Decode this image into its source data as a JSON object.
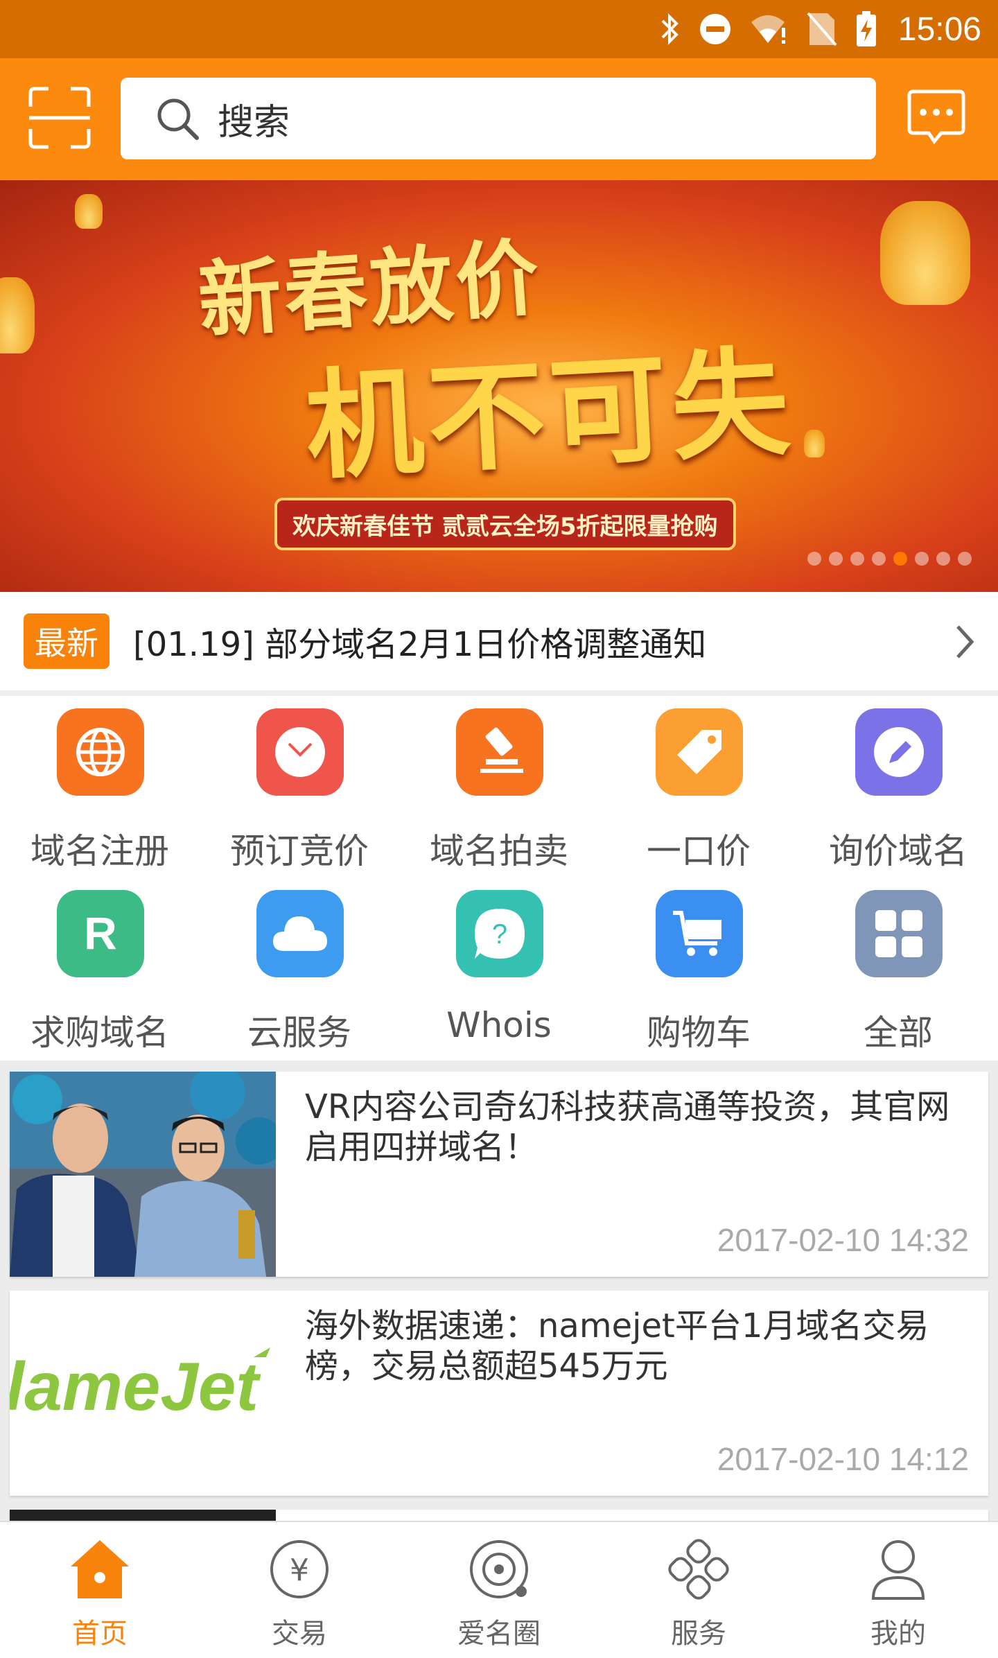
{
  "status_bar": {
    "time": "15:06"
  },
  "top_bar": {
    "search_placeholder": "搜索"
  },
  "banner": {
    "title_line1": "新春放价",
    "title_line2": "机不可失",
    "subtitle": "欢庆新春佳节 贰贰云全场5折起限量抢购",
    "dot_count": 8,
    "active_dot": 4
  },
  "notice": {
    "badge": "最新",
    "text": "[01.19] 部分域名2月1日价格调整通知"
  },
  "grid": {
    "items": [
      {
        "label": "域名注册",
        "icon": "globe-icon",
        "color": "#f8731f"
      },
      {
        "label": "预订竞价",
        "icon": "clock-icon",
        "color": "#f0554b"
      },
      {
        "label": "域名拍卖",
        "icon": "gavel-icon",
        "color": "#f8731f"
      },
      {
        "label": "一口价",
        "icon": "tag-icon",
        "color": "#fb9f33"
      },
      {
        "label": "询价域名",
        "icon": "pencil-icon",
        "color": "#7a72e6"
      },
      {
        "label": "求购域名",
        "icon": "r-letter-icon",
        "color": "#3cbb86"
      },
      {
        "label": "云服务",
        "icon": "cloud-icon",
        "color": "#3d9cf0"
      },
      {
        "label": "Whois",
        "icon": "question-bubble-icon",
        "color": "#35c1b2"
      },
      {
        "label": "购物车",
        "icon": "cart-icon",
        "color": "#3a8ff0"
      },
      {
        "label": "全部",
        "icon": "grid-icon",
        "color": "#8096b8"
      }
    ]
  },
  "feed": {
    "articles": [
      {
        "title": "VR内容公司奇幻科技获高通等投资，其官网启用四拼域名！",
        "time": "2017-02-10 14:32"
      },
      {
        "title": "海外数据速递：namejet平台1月域名交易榜，交易总额超545万元",
        "time": "2017-02-10 14:12",
        "thumb_text": "lameJet"
      }
    ]
  },
  "bottom_nav": {
    "items": [
      {
        "label": "首页",
        "icon": "home-icon",
        "active": true
      },
      {
        "label": "交易",
        "icon": "yen-circle-icon",
        "active": false
      },
      {
        "label": "爱名圈",
        "icon": "target-circle-icon",
        "active": false
      },
      {
        "label": "服务",
        "icon": "clover-icon",
        "active": false
      },
      {
        "label": "我的",
        "icon": "user-icon",
        "active": false
      }
    ]
  },
  "colors": {
    "accent": "#f9820b",
    "status_bar": "#d66d00",
    "top_bar": "#fb8a0e"
  }
}
